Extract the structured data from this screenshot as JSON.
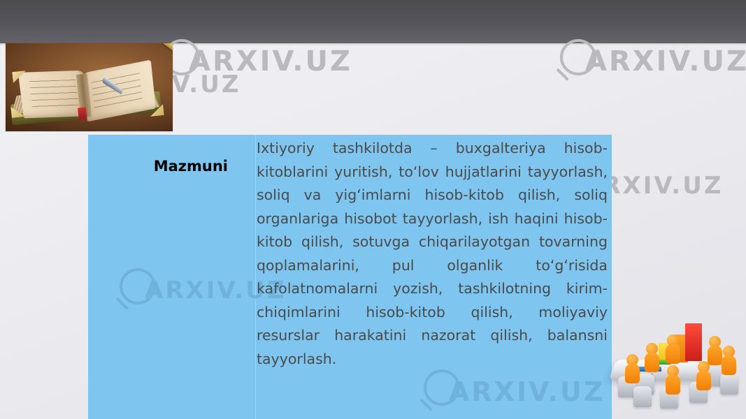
{
  "slide": {
    "content_panel": {
      "label": "Mazmuni",
      "paragraph": "Ixtiyoriy tashkilotda – buxgalteriya hisob-kitoblarini yuritish, to‘lov hujjatlarini tayyorlash, soliq va yig‘imlarni hisob-kitob qilish, soliq organlariga hisobot tayyorlash, ish haqini hisob-kitob qilish, sotuvga chiqarilayotgan tovarning qoplamalarini, pul olganlik to‘g‘risida kafolatnomalarni yozish, tashkilotning kirim-chiqimlarini hisob-kitob qilish, moliyaviy resurslar harakatini nazorat qilish, balansni tayyorlash.",
      "panel_color": "#7ec5f0",
      "label_color": "#000000",
      "text_color": "#4a4a4a"
    },
    "watermarks": [
      {
        "text": "ARXIV.UZ",
        "icon": "magnifier-icon"
      },
      {
        "text": "ARXIV.UZ",
        "icon": "magnifier-icon"
      },
      {
        "text": "ARXIV.UZ",
        "icon": "magnifier-icon"
      },
      {
        "text": "ARXIV.UZ",
        "icon": "magnifier-icon"
      },
      {
        "text": "ARXIV.UZ",
        "icon": "magnifier-icon"
      },
      {
        "text": "ARXIV.UZ",
        "icon": "magnifier-icon"
      }
    ],
    "images": {
      "book_photo_alt": "open-book-with-fountain-pen",
      "meeting_illustration_alt": "orange-figures-conference-table-bar-chart"
    },
    "theme": {
      "top_band_color": "#55555b",
      "background_color": "#eaeaef",
      "watermark_color": "#b9b9be"
    }
  }
}
